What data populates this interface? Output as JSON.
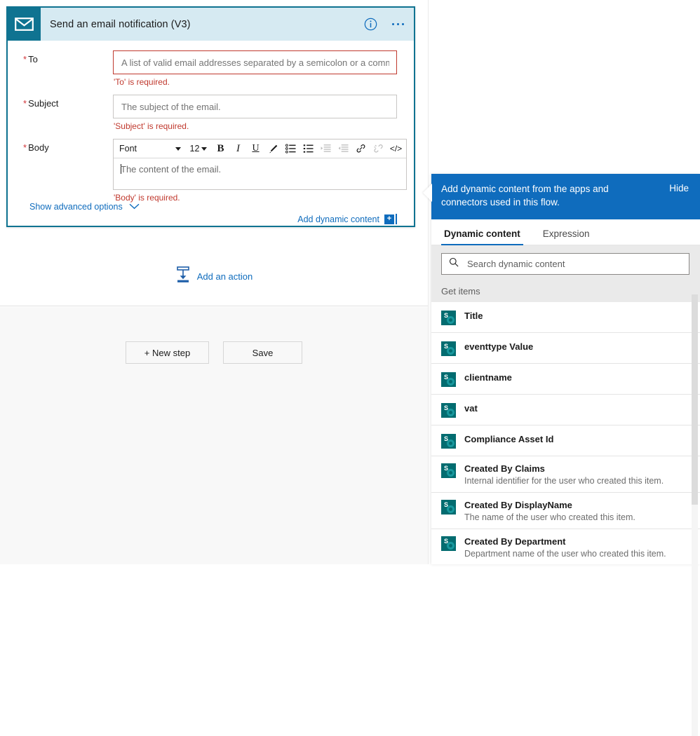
{
  "card": {
    "icon": "envelope-icon",
    "title": "Send an email notification (V3)",
    "info_icon": "info-circle-icon",
    "more_icon": "ellipsis-icon",
    "accent_color": "#0f7391",
    "header_bg": "#d6eaf2",
    "fields": [
      {
        "label": "To",
        "required_marker": "*",
        "placeholder": "A list of valid email addresses separated by a semicolon or a comma.",
        "value": "",
        "error": "'To' is required.",
        "state": "error"
      },
      {
        "label": "Subject",
        "required_marker": "*",
        "placeholder": "The subject of the email.",
        "value": "",
        "error": "'Subject' is required.",
        "state": "normal"
      },
      {
        "label": "Body",
        "required_marker": "*",
        "placeholder": "The content of the email.",
        "value": "",
        "error": "'Body' is required.",
        "state": "normal"
      }
    ],
    "editor_toolbar": {
      "font_name": "Font",
      "font_size": "12",
      "buttons": [
        {
          "name": "bold-icon",
          "label": "B",
          "disabled": false
        },
        {
          "name": "italic-icon",
          "label": "I",
          "disabled": false
        },
        {
          "name": "underline-icon",
          "label": "U",
          "disabled": false
        },
        {
          "name": "highlighter-pen-icon",
          "label": "",
          "disabled": false
        },
        {
          "name": "bulleted-list-icon",
          "label": "",
          "disabled": false
        },
        {
          "name": "numbered-list-icon",
          "label": "",
          "disabled": false
        },
        {
          "name": "increase-indent-icon",
          "label": "",
          "disabled": true
        },
        {
          "name": "decrease-indent-icon",
          "label": "",
          "disabled": true
        },
        {
          "name": "insert-link-icon",
          "label": "",
          "disabled": false
        },
        {
          "name": "remove-link-icon",
          "label": "",
          "disabled": true
        },
        {
          "name": "code-view-icon",
          "label": "</>",
          "disabled": false
        }
      ]
    },
    "add_dynamic_content_label": "Add dynamic content",
    "add_dynamic_content_icon": "plus-square-icon",
    "show_advanced_options_label": "Show advanced options",
    "show_advanced_options_icon": "chevron-down-icon"
  },
  "designer": {
    "add_action_label": "Add an action",
    "add_action_icon": "insert-action-icon",
    "buttons": [
      {
        "label": "+ New step",
        "name": "new-step-button"
      },
      {
        "label": "Save",
        "name": "save-button"
      }
    ]
  },
  "dynamic_panel": {
    "header_text": "Add dynamic content from the apps and connectors used in this flow.",
    "hide_label": "Hide",
    "header_color": "#0f6cbd",
    "tabs": [
      {
        "label": "Dynamic content",
        "active": true
      },
      {
        "label": "Expression",
        "active": false
      }
    ],
    "search": {
      "placeholder": "Search dynamic content",
      "value": "",
      "icon": "search-icon"
    },
    "group_label": "Get items",
    "items": [
      {
        "label": "Title",
        "desc": "",
        "icon": "sharepoint-icon"
      },
      {
        "label": "eventtype Value",
        "desc": "",
        "icon": "sharepoint-icon"
      },
      {
        "label": "clientname",
        "desc": "",
        "icon": "sharepoint-icon"
      },
      {
        "label": "vat",
        "desc": "",
        "icon": "sharepoint-icon"
      },
      {
        "label": "Compliance Asset Id",
        "desc": "",
        "icon": "sharepoint-icon"
      },
      {
        "label": "Created By Claims",
        "desc": "Internal identifier for the user who created this item.",
        "icon": "sharepoint-icon"
      },
      {
        "label": "Created By DisplayName",
        "desc": "The name of the user who created this item.",
        "icon": "sharepoint-icon"
      },
      {
        "label": "Created By Department",
        "desc": "Department name of the user who created this item.",
        "icon": "sharepoint-icon"
      }
    ]
  }
}
